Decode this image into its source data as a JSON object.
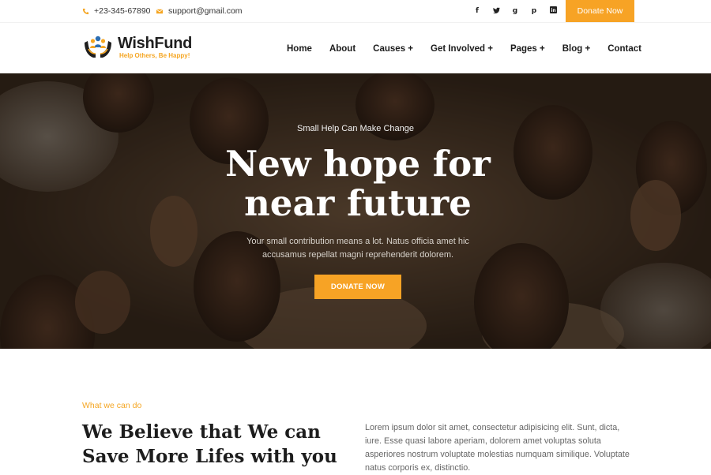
{
  "topbar": {
    "phone": "+23-345-67890",
    "email": "support@gmail.com",
    "socials": [
      "facebook-icon",
      "twitter-icon",
      "google-plus-icon",
      "pinterest-icon",
      "linkedin-icon"
    ],
    "social_glyphs": [
      "f",
      "t",
      "g",
      "p",
      "in"
    ],
    "donate_label": "Donate Now"
  },
  "brand": {
    "name": "WishFund",
    "tagline": "Help Others, Be Happy!"
  },
  "nav": {
    "items": [
      "Home",
      "About",
      "Causes +",
      "Get Involved +",
      "Pages +",
      "Blog +",
      "Contact"
    ]
  },
  "hero": {
    "subtitle": "Small Help Can Make Change",
    "title_line1": "New hope for",
    "title_line2": "near future",
    "description": "Your small contribution means a lot. Natus officia amet hic accusamus repellat magni reprehenderit dolorem.",
    "button_label": "DONATE NOW"
  },
  "about": {
    "eyebrow": "What we can do",
    "heading_line1": "We Believe that We can",
    "heading_line2": "Save More Lifes with you",
    "text": "Lorem ipsum dolor sit amet, consectetur adipisicing elit. Sunt, dicta, iure. Esse quasi labore aperiam, dolorem amet voluptas soluta asperiores nostrum voluptate molestias numquam similique. Voluptate natus corporis ex, distinctio."
  },
  "colors": {
    "accent": "#f7a325",
    "dark": "#1c1c1c"
  }
}
